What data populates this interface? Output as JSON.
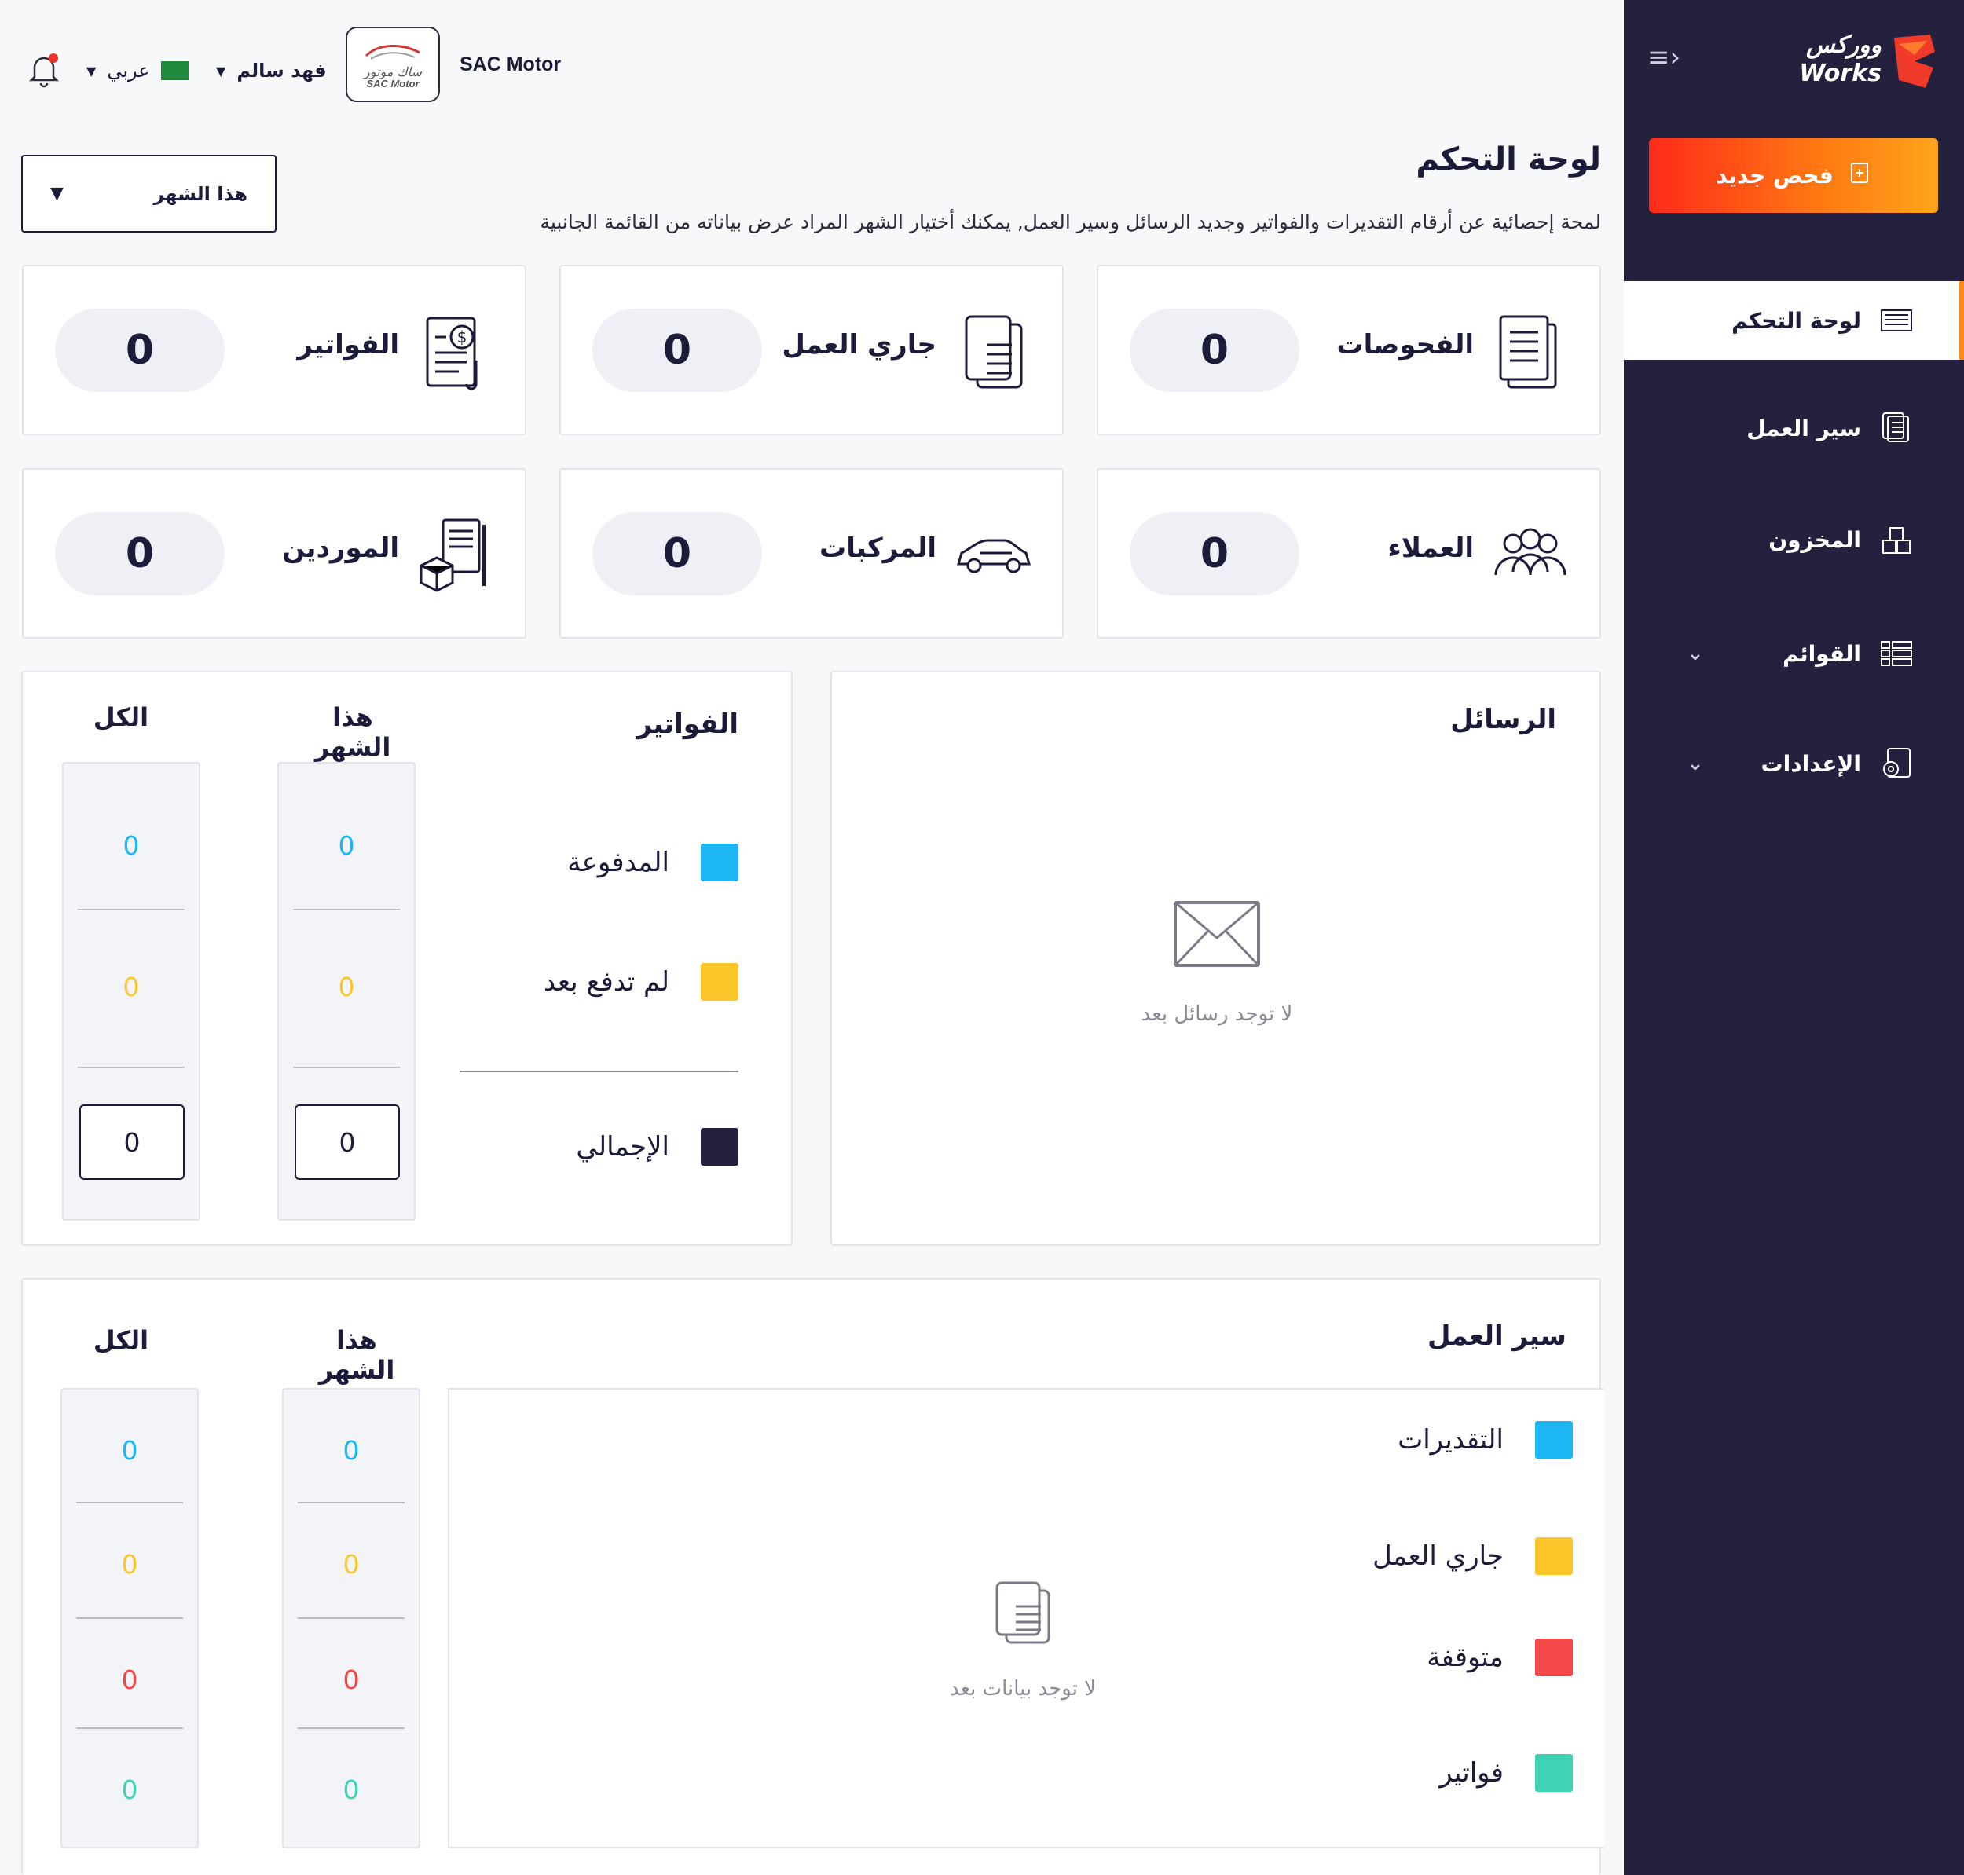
{
  "sidebar": {
    "brand_ar": "ووركس",
    "brand_en": "Works",
    "new_button": "فحص جديد",
    "items": [
      {
        "label": "لوحة التحكم"
      },
      {
        "label": "سير العمل"
      },
      {
        "label": "المخزون"
      },
      {
        "label": "القوائم"
      },
      {
        "label": "الإعدادات"
      }
    ]
  },
  "header": {
    "language": "عربي",
    "user_name": "فهد سالم",
    "company_logo_text": "ساك موتور SAC Motor",
    "company_name": "SAC Motor"
  },
  "page": {
    "title": "لوحة التحكم",
    "subtitle": "لمحة إحصائية عن أرقام التقديرات والفواتير  وجديد الرسائل  وسير العمل, يمكنك أختيار الشهر المراد عرض بياناته من القائمة الجانبية",
    "month_select": "هذا الشهر"
  },
  "stats": [
    {
      "label": "الفحوصات",
      "value": "0"
    },
    {
      "label": "جاري العمل",
      "value": "0"
    },
    {
      "label": "الفواتير",
      "value": "0"
    },
    {
      "label": "العملاء",
      "value": "0"
    },
    {
      "label": "المركبات",
      "value": "0"
    },
    {
      "label": "الموردين",
      "value": "0"
    }
  ],
  "messages": {
    "title": "الرسائل",
    "empty": "لا توجد رسائل بعد"
  },
  "invoices": {
    "title": "الفواتير",
    "col_month": "هذا الشهر",
    "col_all": "الكل",
    "legend": [
      "المدفوعة",
      "لم تدفع بعد",
      "الإجمالي"
    ],
    "month_values": [
      "0",
      "0",
      "0"
    ],
    "all_values": [
      "0",
      "0",
      "0"
    ]
  },
  "workflow": {
    "title": "سير العمل",
    "col_month": "هذا الشهر",
    "col_all": "الكل",
    "legend": [
      "التقديرات",
      "جاري العمل",
      "متوقفة",
      "فواتير"
    ],
    "month_values": [
      "0",
      "0",
      "0",
      "0"
    ],
    "all_values": [
      "0",
      "0",
      "0",
      "0"
    ],
    "empty": "لا توجد بيانات بعد"
  },
  "colors": {
    "sidebar": "#24213f",
    "blue": "#1cb6f5",
    "yellow": "#fcc62b",
    "red": "#f44747",
    "teal": "#3fd3b5",
    "navy": "#24213f"
  }
}
